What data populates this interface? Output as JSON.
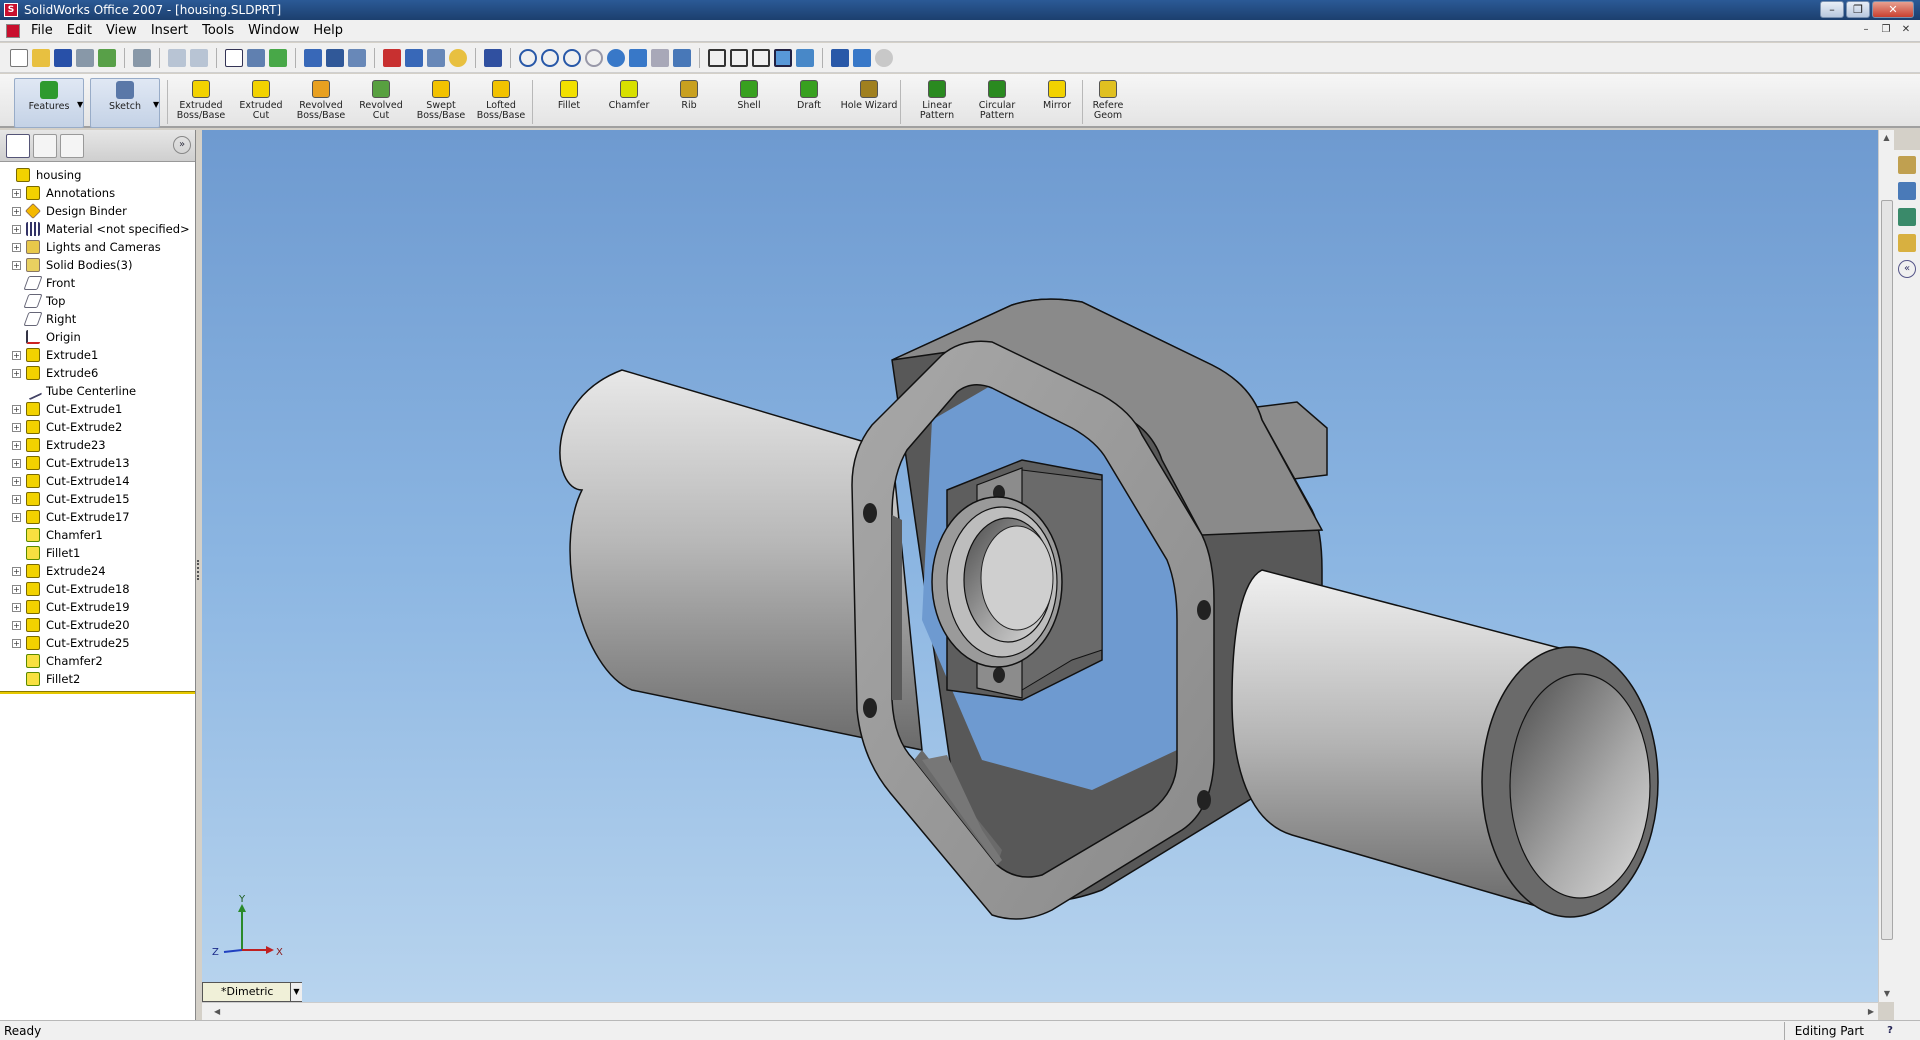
{
  "window": {
    "title": "SolidWorks Office 2007 - [housing.SLDPRT]"
  },
  "menu": [
    "File",
    "Edit",
    "View",
    "Insert",
    "Tools",
    "Window",
    "Help"
  ],
  "command_manager": {
    "tabs": [
      {
        "label": "Features"
      },
      {
        "label": "Sketch"
      }
    ],
    "buttons": [
      {
        "line1": "Extruded",
        "line2": "Boss/Base",
        "color": "#f2d200"
      },
      {
        "line1": "Extruded Cut",
        "line2": "",
        "color": "#f2d200"
      },
      {
        "line1": "Revolved",
        "line2": "Boss/Base",
        "color": "#e8a020"
      },
      {
        "line1": "Revolved Cut",
        "line2": "",
        "color": "#58a040"
      },
      {
        "line1": "Swept",
        "line2": "Boss/Base",
        "color": "#f2c200"
      },
      {
        "line1": "Lofted",
        "line2": "Boss/Base",
        "color": "#f2c200"
      },
      {
        "line1": "Fillet",
        "line2": "",
        "color": "#f2e000"
      },
      {
        "line1": "Chamfer",
        "line2": "",
        "color": "#d8e000"
      },
      {
        "line1": "Rib",
        "line2": "",
        "color": "#c8a020"
      },
      {
        "line1": "Shell",
        "line2": "",
        "color": "#38a020"
      },
      {
        "line1": "Draft",
        "line2": "",
        "color": "#38a020"
      },
      {
        "line1": "Hole Wizard",
        "line2": "",
        "color": "#a08020"
      },
      {
        "line1": "Linear",
        "line2": "Pattern",
        "color": "#2a8a20"
      },
      {
        "line1": "Circular",
        "line2": "Pattern",
        "color": "#2a8a20"
      },
      {
        "line1": "Mirror",
        "line2": "",
        "color": "#f2d200"
      },
      {
        "line1": "Refere",
        "line2": "Geom",
        "color": "#e0c020"
      }
    ]
  },
  "tree": {
    "root": "housing",
    "items": [
      {
        "label": "Annotations",
        "expandable": true,
        "icon": "annot"
      },
      {
        "label": "Design Binder",
        "expandable": true,
        "icon": "binder"
      },
      {
        "label": "Material <not specified>",
        "expandable": true,
        "icon": "mat"
      },
      {
        "label": "Lights and Cameras",
        "expandable": true,
        "icon": "light"
      },
      {
        "label": "Solid Bodies(3)",
        "expandable": true,
        "icon": "solid"
      },
      {
        "label": "Front",
        "expandable": false,
        "icon": "plane"
      },
      {
        "label": "Top",
        "expandable": false,
        "icon": "plane"
      },
      {
        "label": "Right",
        "expandable": false,
        "icon": "plane"
      },
      {
        "label": "Origin",
        "expandable": false,
        "icon": "origin"
      },
      {
        "label": "Extrude1",
        "expandable": true,
        "icon": "feat"
      },
      {
        "label": "Extrude6",
        "expandable": true,
        "icon": "feat"
      },
      {
        "label": "Tube Centerline",
        "expandable": false,
        "icon": "sketch"
      },
      {
        "label": "Cut-Extrude1",
        "expandable": true,
        "icon": "feat"
      },
      {
        "label": "Cut-Extrude2",
        "expandable": true,
        "icon": "feat"
      },
      {
        "label": "Extrude23",
        "expandable": true,
        "icon": "feat"
      },
      {
        "label": "Cut-Extrude13",
        "expandable": true,
        "icon": "feat"
      },
      {
        "label": "Cut-Extrude14",
        "expandable": true,
        "icon": "feat"
      },
      {
        "label": "Cut-Extrude15",
        "expandable": true,
        "icon": "feat"
      },
      {
        "label": "Cut-Extrude17",
        "expandable": true,
        "icon": "feat"
      },
      {
        "label": "Chamfer1",
        "expandable": false,
        "icon": "chamf"
      },
      {
        "label": "Fillet1",
        "expandable": false,
        "icon": "chamf"
      },
      {
        "label": "Extrude24",
        "expandable": true,
        "icon": "feat"
      },
      {
        "label": "Cut-Extrude18",
        "expandable": true,
        "icon": "feat"
      },
      {
        "label": "Cut-Extrude19",
        "expandable": true,
        "icon": "feat"
      },
      {
        "label": "Cut-Extrude20",
        "expandable": true,
        "icon": "feat"
      },
      {
        "label": "Cut-Extrude25",
        "expandable": true,
        "icon": "feat"
      },
      {
        "label": "Chamfer2",
        "expandable": false,
        "icon": "chamf"
      },
      {
        "label": "Fillet2",
        "expandable": false,
        "icon": "chamf"
      }
    ]
  },
  "viewport": {
    "view_orientation": "*Dimetric",
    "triad": {
      "y": "Y",
      "z": "Z",
      "x": "X"
    }
  },
  "status": {
    "left": "Ready",
    "right": "Editing Part",
    "help": "?"
  }
}
